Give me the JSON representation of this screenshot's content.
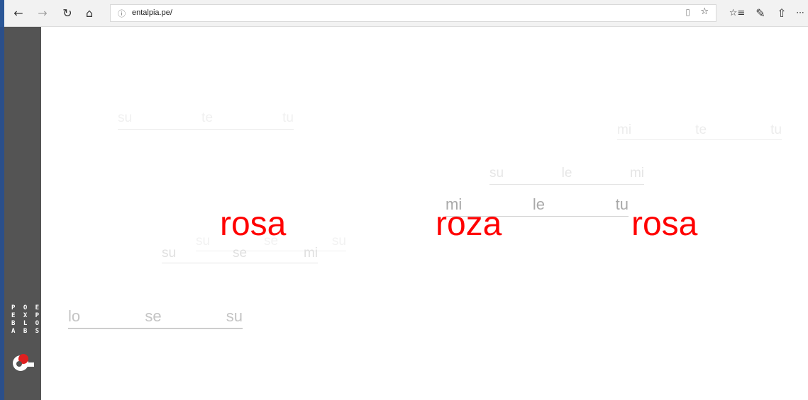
{
  "browser": {
    "back_icon": "←",
    "forward_icon": "→",
    "refresh_icon": "↻",
    "home_icon": "⌂",
    "info_icon": "ⓘ",
    "url": "entalpia.pe/",
    "reading_view_icon": "▯",
    "favorite_icon": "☆",
    "favorites_list_icon": "☆≡",
    "pen_icon": "✎",
    "share_icon": "⇧",
    "more_icon": "···"
  },
  "sidebar": {
    "logo_lines": [
      "P O E",
      "E X P",
      "B L O",
      "A B S"
    ]
  },
  "rows": [
    {
      "words": [
        "su",
        "te",
        "tu"
      ]
    },
    {
      "words": [
        "mi",
        "te",
        "tu"
      ]
    },
    {
      "words": [
        "su",
        "le",
        "mi"
      ]
    },
    {
      "words": [
        "mi",
        "le",
        "tu"
      ]
    },
    {
      "words": [
        "su",
        "se",
        "su"
      ]
    },
    {
      "words": [
        "su",
        "se",
        "mi"
      ]
    },
    {
      "words": [
        "lo",
        "se",
        "su"
      ]
    }
  ],
  "red_words": [
    "rosa",
    "roza",
    "rosa"
  ],
  "colors": {
    "red": "#ff0000",
    "sidebar": "#545454",
    "accent": "#2b5797"
  }
}
